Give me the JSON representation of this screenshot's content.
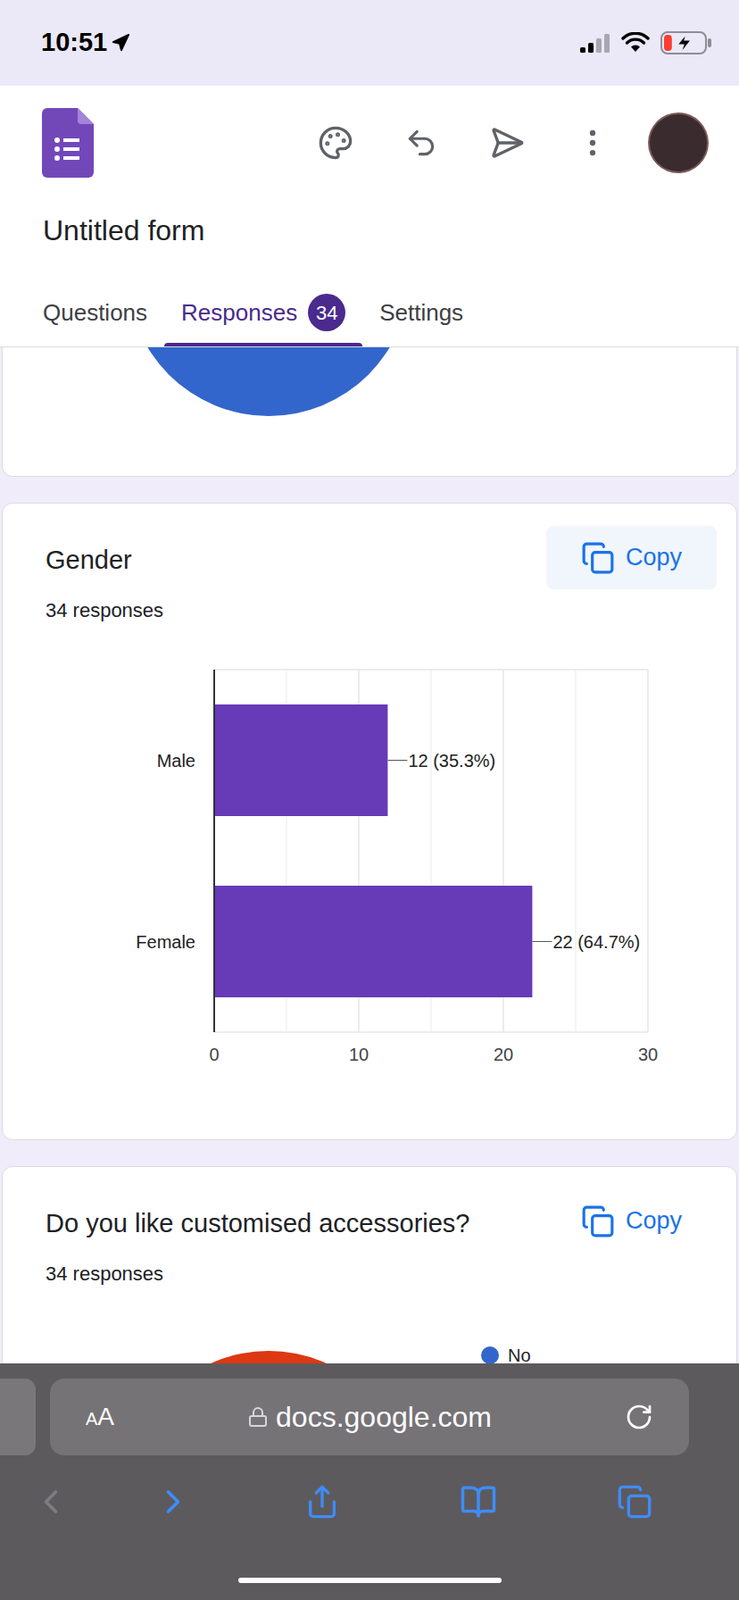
{
  "status_bar": {
    "time": "10:51",
    "signal_bars": 2,
    "battery": {
      "level": 0.2,
      "charging": true
    }
  },
  "app": {
    "title": "Untitled form"
  },
  "tabs": [
    {
      "label": "Questions",
      "selected": false,
      "badge": ""
    },
    {
      "label": "Responses",
      "selected": true,
      "badge": "34"
    },
    {
      "label": "Settings",
      "selected": false,
      "badge": ""
    }
  ],
  "previous_chart": {
    "color": "#3366cc"
  },
  "gender_chart": {
    "title": "Gender",
    "responses": "34 responses",
    "copy": {
      "label": "Copy",
      "highlighted": true
    },
    "categories": [
      "Male",
      "Female"
    ],
    "values": [
      12,
      22
    ],
    "value_labels": [
      "12 (35.3%)",
      "22 (64.7%)"
    ],
    "axis_max": 30,
    "ticks": [
      "0",
      "10",
      "20",
      "30"
    ],
    "color": "#673ab7"
  },
  "accessories_chart": {
    "title": "Do you like customised accessories?",
    "responses": "34 responses",
    "copy": {
      "label": "Copy",
      "highlighted": false
    },
    "pie_color": "#dc3912",
    "legend": [
      {
        "label": "No",
        "color": "#3366cc"
      }
    ]
  },
  "browser": {
    "text_size_button": "AA",
    "url": "docs.google.com",
    "back_enabled": false,
    "forward_enabled": true
  }
}
